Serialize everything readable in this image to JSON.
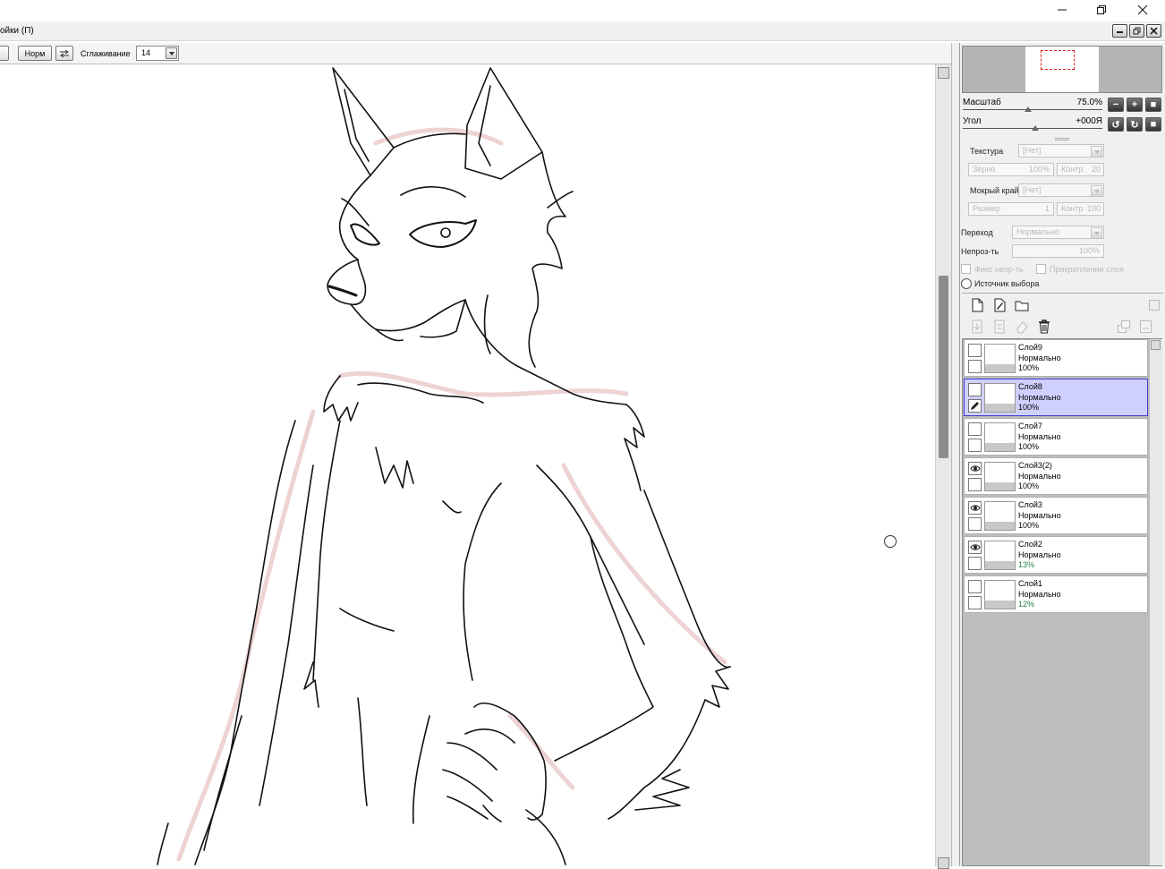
{
  "window": {
    "menu_tail": "ойки (П)"
  },
  "toolbar": {
    "mode_label": "Норм",
    "smoothing_label": "Сглаживание",
    "smoothing_value": "14"
  },
  "navigator": {
    "zoom_label": "Масштаб",
    "zoom_value": "75.0%",
    "angle_label": "Угол",
    "angle_value": "+000Я"
  },
  "brush": {
    "texture_label": "Текстура",
    "texture_value": "[Нет]",
    "grain_label": "Зерно",
    "grain_value": "100%",
    "contrast_label": "Контр",
    "contrast_value": "20",
    "wet_edge_label": "Мокрый край",
    "wet_edge_value": "[Нет]",
    "size_label": "Размер",
    "size_value": "1",
    "contrast2_label": "Контр",
    "contrast2_value": "100",
    "blend_label": "Переход",
    "blend_value": "Нормально",
    "opacity_label": "Непроз-ть",
    "opacity_value": "100%",
    "fix_opacity_label": "Фикс непр-ть",
    "clip_layer_label": "Прикрепление слоя",
    "selection_source_label": "Источник выбора"
  },
  "layers": [
    {
      "name": "Слой9",
      "mode": "Нормально",
      "opacity": "100%",
      "visible": false,
      "selected": false,
      "low": false
    },
    {
      "name": "Слой8",
      "mode": "Нормально",
      "opacity": "100%",
      "visible": false,
      "selected": true,
      "low": false
    },
    {
      "name": "Слой7",
      "mode": "Нормально",
      "opacity": "100%",
      "visible": false,
      "selected": false,
      "low": false
    },
    {
      "name": "Слой3(2)",
      "mode": "Нормально",
      "opacity": "100%",
      "visible": true,
      "selected": false,
      "low": false
    },
    {
      "name": "Слой3",
      "mode": "Нормально",
      "opacity": "100%",
      "visible": true,
      "selected": false,
      "low": false
    },
    {
      "name": "Слой2",
      "mode": "Нормально",
      "opacity": "13%",
      "visible": true,
      "selected": false,
      "low": true
    },
    {
      "name": "Слой1",
      "mode": "Нормально",
      "opacity": "12%",
      "visible": false,
      "selected": false,
      "low": true
    }
  ],
  "icons": {
    "minimize": "minimize-icon",
    "restore": "restore-icon",
    "close": "close-icon",
    "new_layer": "new-layer-icon",
    "new_linework": "new-linework-layer-icon",
    "new_folder": "new-folder-icon",
    "delete": "trash-icon",
    "visibility": "eye-icon",
    "edit": "pen-icon"
  }
}
